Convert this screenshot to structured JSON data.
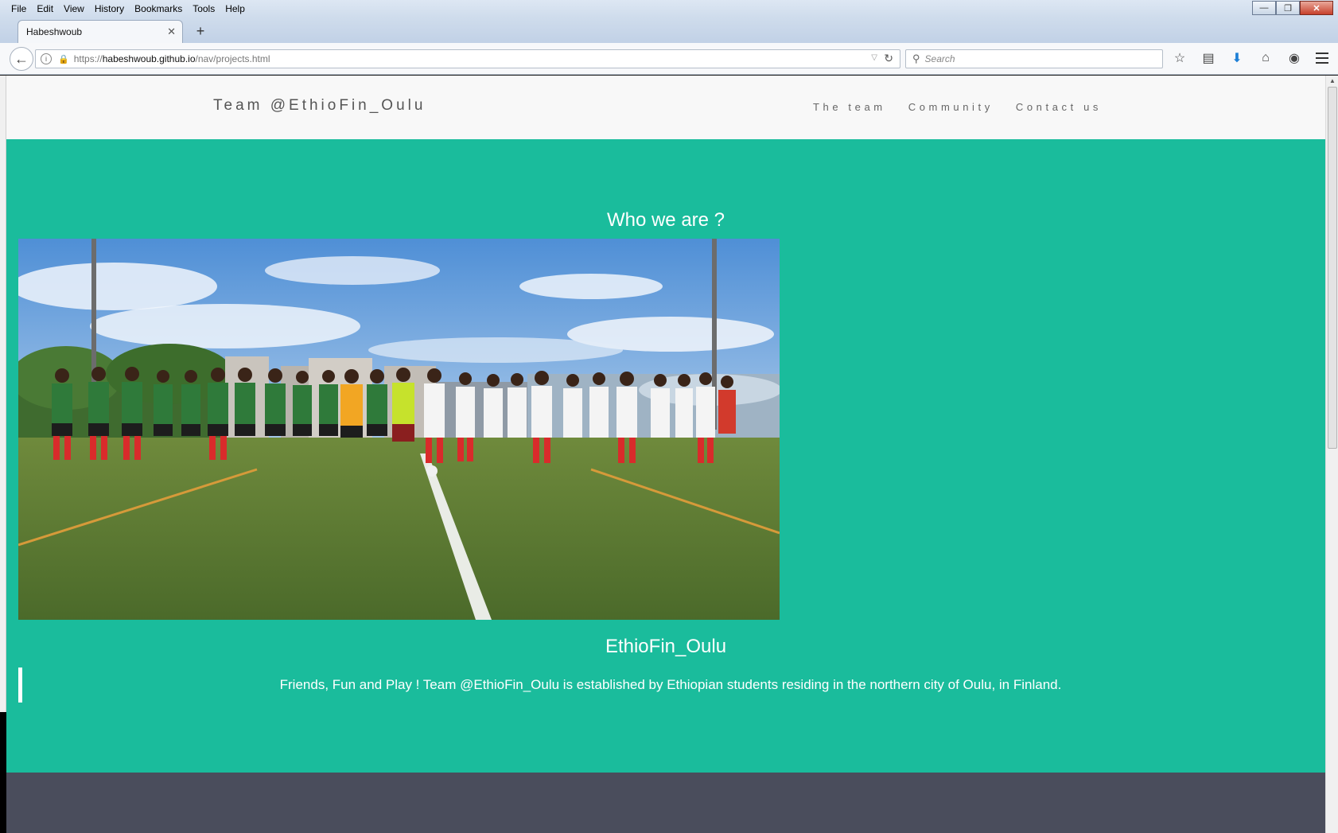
{
  "browser": {
    "menu": [
      "File",
      "Edit",
      "View",
      "History",
      "Bookmarks",
      "Tools",
      "Help"
    ],
    "tab_title": "Habeshwoub",
    "url_prefix": "https://",
    "url_host": "habeshwoub.github.io",
    "url_path": "/nav/projects.html",
    "search_placeholder": "Search"
  },
  "site": {
    "brand": "Team @EthioFin_Oulu",
    "nav": [
      "The team",
      "Community",
      "Contact us"
    ]
  },
  "hero": {
    "heading": "Who we are ?",
    "photo_alt": "Team photo",
    "team_name": "EthioFin_Oulu",
    "description": "Friends, Fun and Play ! Team @EthioFin_Oulu is established by Ethiopian students residing in the northern city of Oulu, in Finland."
  },
  "colors": {
    "accent": "#1abc9c",
    "footer": "#4a4d5c"
  }
}
